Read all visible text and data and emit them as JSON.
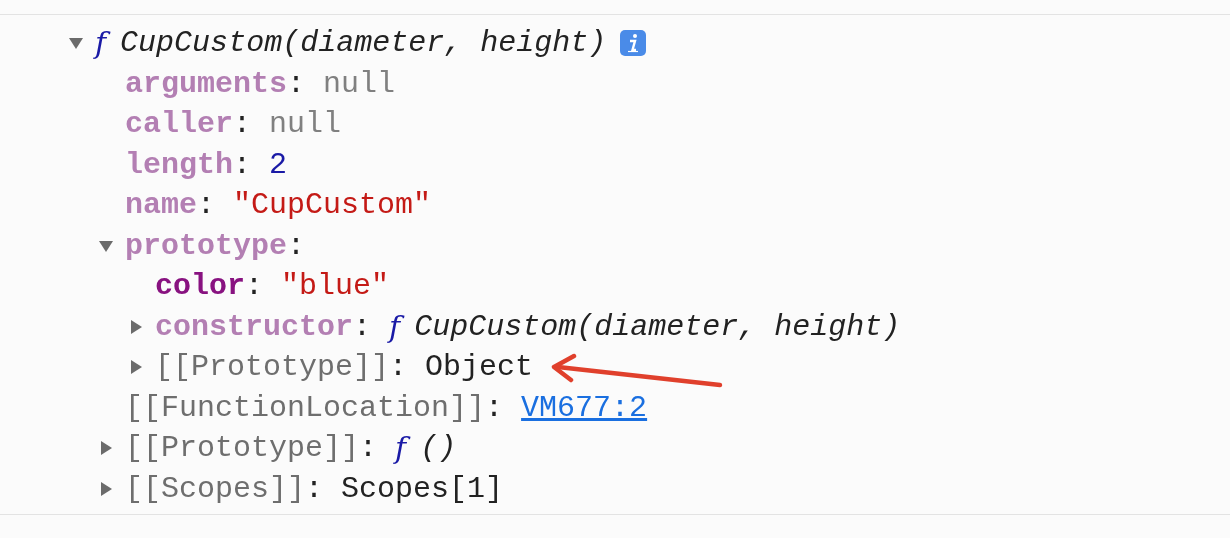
{
  "tree": {
    "expanded": true,
    "value": {
      "kind": "function",
      "prefix": "f",
      "text": "CupCustom(diameter, height)"
    },
    "info": true,
    "children": [
      {
        "key": {
          "kind": "own",
          "text": "arguments"
        },
        "separator": ":",
        "value": {
          "kind": "null",
          "text": "null"
        }
      },
      {
        "key": {
          "kind": "own",
          "text": "caller"
        },
        "separator": ":",
        "value": {
          "kind": "null",
          "text": "null"
        }
      },
      {
        "key": {
          "kind": "own",
          "text": "length"
        },
        "separator": ":",
        "value": {
          "kind": "number",
          "text": "2"
        }
      },
      {
        "key": {
          "kind": "own",
          "text": "name"
        },
        "separator": ":",
        "value": {
          "kind": "string",
          "text": "\"CupCustom\""
        }
      },
      {
        "key": {
          "kind": "own",
          "text": "prototype"
        },
        "separator": ":",
        "expanded": true,
        "children": [
          {
            "key": {
              "kind": "enumerable",
              "text": "color"
            },
            "separator": ":",
            "value": {
              "kind": "string",
              "text": "\"blue\""
            }
          },
          {
            "key": {
              "kind": "own",
              "text": "constructor"
            },
            "separator": ":",
            "expanded": false,
            "value": {
              "kind": "function",
              "prefix": "f",
              "text": "CupCustom(diameter, height)"
            }
          },
          {
            "key": {
              "kind": "internal",
              "text": "[[Prototype]]"
            },
            "separator": ":",
            "expanded": false,
            "value": {
              "kind": "object",
              "text": "Object"
            }
          }
        ]
      },
      {
        "key": {
          "kind": "internal",
          "text": "[[FunctionLocation]]"
        },
        "separator": ":",
        "value": {
          "kind": "link",
          "text": "VM677:2"
        }
      },
      {
        "key": {
          "kind": "internal",
          "text": "[[Prototype]]"
        },
        "separator": ":",
        "expanded": false,
        "value": {
          "kind": "function",
          "prefix": "f",
          "text": "()"
        }
      },
      {
        "key": {
          "kind": "internal",
          "text": "[[Scopes]]"
        },
        "separator": ":",
        "expanded": false,
        "value": {
          "kind": "object",
          "text": "Scopes[1]"
        }
      }
    ]
  }
}
